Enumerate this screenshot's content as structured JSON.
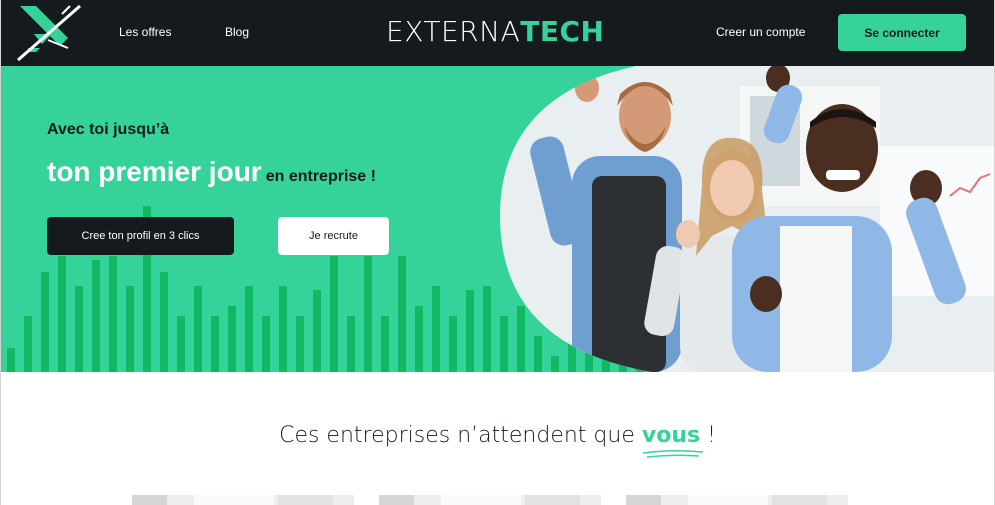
{
  "header": {
    "nav_links": [
      "Les offres",
      "Blog"
    ],
    "brand_prefix": "EXTERNA",
    "brand_suffix": "TECH",
    "create_account": "Creer un compte",
    "sign_in": "Se connecter",
    "logo_icon": "x-logo-icon"
  },
  "hero": {
    "kicker": "Avec toi jusqu’à",
    "title_big": "ton premier jour",
    "title_small": "en entreprise !",
    "primary_cta": "Cree ton profil en 3 clics",
    "secondary_cta": "Je recrute",
    "photo": "team-celebrating-photo"
  },
  "companies": {
    "heading_before": "Ces entreprises n’attendent que",
    "heading_highlight": "vous",
    "heading_after": "!"
  },
  "colors": {
    "accent": "#35d39a",
    "dark": "#141a1d",
    "bars": "#13b865"
  }
}
